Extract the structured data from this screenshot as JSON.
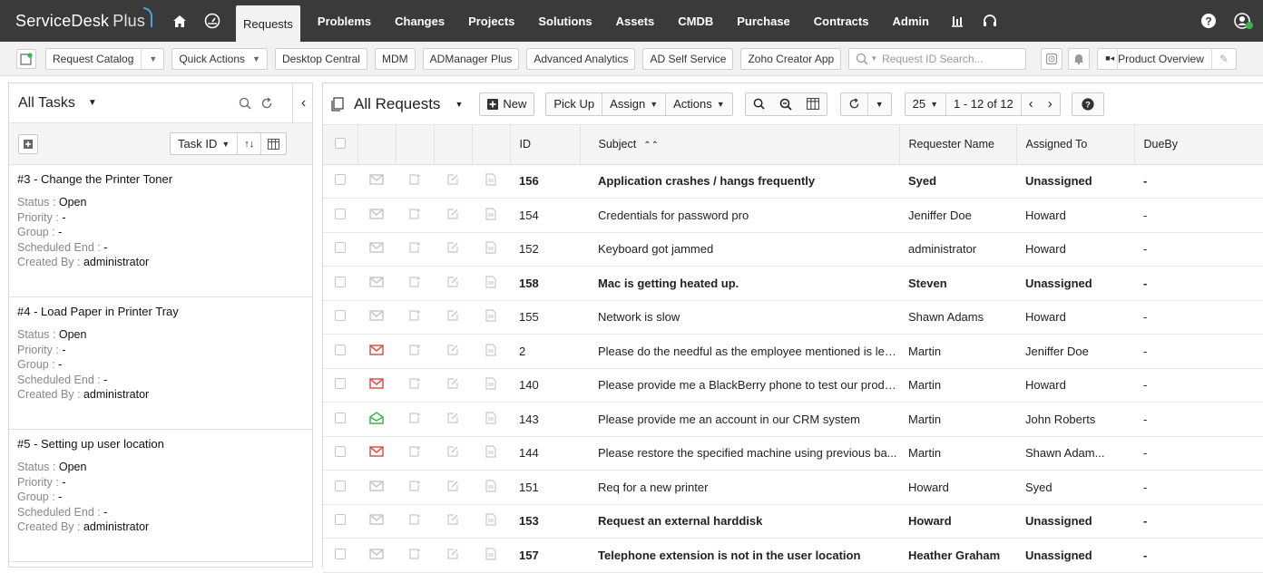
{
  "app": {
    "name": "ServiceDesk",
    "name_suffix": "Plus"
  },
  "nav": {
    "active_tab": "Requests",
    "tabs": [
      "Problems",
      "Changes",
      "Projects",
      "Solutions",
      "Assets",
      "CMDB",
      "Purchase",
      "Contracts",
      "Admin"
    ]
  },
  "toolbar": {
    "request_catalog": "Request Catalog",
    "quick_actions": "Quick Actions",
    "links": [
      "Desktop Central",
      "MDM",
      "ADManager Plus",
      "Advanced Analytics",
      "AD Self Service",
      "Zoho Creator App"
    ],
    "search_placeholder": "Request ID Search...",
    "product_overview": "Product Overview"
  },
  "tasks_panel": {
    "title": "All Tasks",
    "sort_label": "Task ID",
    "labels": {
      "status": "Status :",
      "priority": "Priority :",
      "group": "Group :",
      "scheduled_end": "Scheduled End :",
      "created_by": "Created By :"
    },
    "tasks": [
      {
        "title": "#3 - Change the Printer Toner",
        "status": "Open",
        "priority": "-",
        "group": "-",
        "scheduled_end": "-",
        "created_by": "administrator"
      },
      {
        "title": "#4 - Load Paper in Printer Tray",
        "status": "Open",
        "priority": "-",
        "group": "-",
        "scheduled_end": "-",
        "created_by": "administrator"
      },
      {
        "title": "#5 - Setting up user location",
        "status": "Open",
        "priority": "-",
        "group": "-",
        "scheduled_end": "-",
        "created_by": "administrator"
      }
    ]
  },
  "requests": {
    "title": "All Requests",
    "new_label": "New",
    "pickup_label": "Pick Up",
    "assign_label": "Assign",
    "actions_label": "Actions",
    "per_page": "25",
    "range": "1 - 12 of 12",
    "columns": {
      "id": "ID",
      "subject": "Subject",
      "requester": "Requester Name",
      "assigned": "Assigned To",
      "dueby": "DueBy"
    },
    "colors": {
      "unread_mail": "#e05050",
      "green_mail": "#3bb54a",
      "grey_icon": "#c8c8c8"
    },
    "rows": [
      {
        "id": "156",
        "subject": "Application crashes / hangs frequently",
        "requester": "Syed",
        "assigned": "Unassigned",
        "dueby": "-",
        "bold": true,
        "mail": "grey"
      },
      {
        "id": "154",
        "subject": "Credentials for password pro",
        "requester": "Jeniffer Doe",
        "assigned": "Howard",
        "dueby": "-",
        "bold": false,
        "mail": "grey"
      },
      {
        "id": "152",
        "subject": "Keyboard got jammed",
        "requester": "administrator",
        "assigned": "Howard",
        "dueby": "-",
        "bold": false,
        "mail": "grey"
      },
      {
        "id": "158",
        "subject": "Mac is getting heated up.",
        "requester": "Steven",
        "assigned": "Unassigned",
        "dueby": "-",
        "bold": true,
        "mail": "grey"
      },
      {
        "id": "155",
        "subject": "Network is slow",
        "requester": "Shawn Adams",
        "assigned": "Howard",
        "dueby": "-",
        "bold": false,
        "mail": "grey"
      },
      {
        "id": "2",
        "subject": "Please do the needful as the employee mentioned is lea...",
        "requester": "Martin",
        "assigned": "Jeniffer Doe",
        "dueby": "-",
        "bold": false,
        "mail": "red"
      },
      {
        "id": "140",
        "subject": "Please provide me a BlackBerry phone to test our produ...",
        "requester": "Martin",
        "assigned": "Howard",
        "dueby": "-",
        "bold": false,
        "mail": "red"
      },
      {
        "id": "143",
        "subject": "Please provide me an account in our CRM system",
        "requester": "Martin",
        "assigned": "John Roberts",
        "dueby": "-",
        "bold": false,
        "mail": "green"
      },
      {
        "id": "144",
        "subject": "Please restore the specified machine using previous ba...",
        "requester": "Martin",
        "assigned": "Shawn Adam...",
        "dueby": "-",
        "bold": false,
        "mail": "red"
      },
      {
        "id": "151",
        "subject": "Req for a new printer",
        "requester": "Howard",
        "assigned": "Syed",
        "dueby": "-",
        "bold": false,
        "mail": "grey"
      },
      {
        "id": "153",
        "subject": "Request an external harddisk",
        "requester": "Howard",
        "assigned": "Unassigned",
        "dueby": "-",
        "bold": true,
        "mail": "grey"
      },
      {
        "id": "157",
        "subject": "Telephone extension is not in the user location",
        "requester": "Heather Graham",
        "assigned": "Unassigned",
        "dueby": "-",
        "bold": true,
        "mail": "grey"
      }
    ]
  }
}
